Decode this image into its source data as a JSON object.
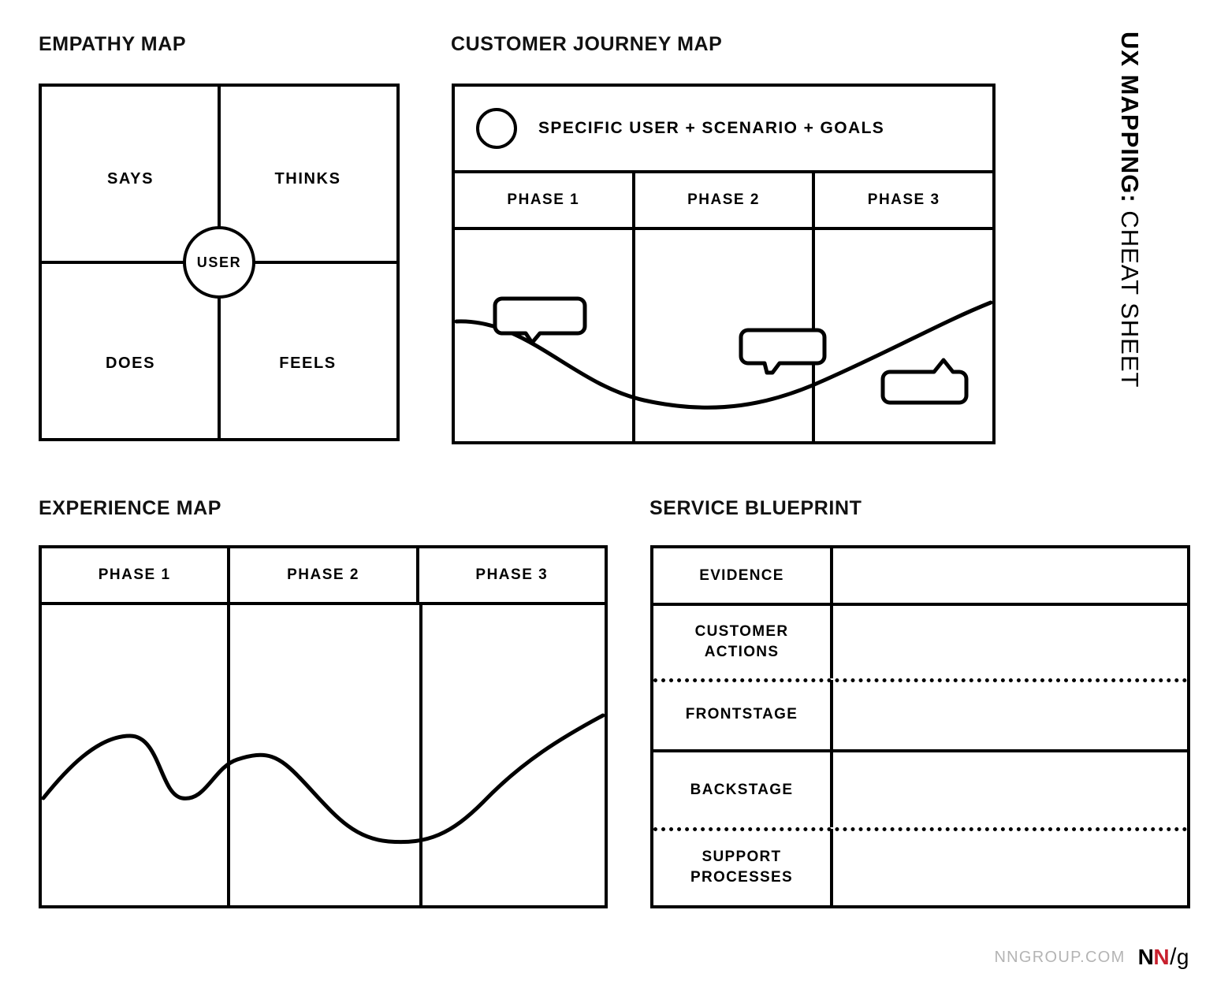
{
  "vertical_title": {
    "bold": "UX MAPPING:",
    "light": " CHEAT SHEET"
  },
  "sections": {
    "empathy": {
      "title": "EMPATHY MAP",
      "quadrants": [
        "SAYS",
        "THINKS",
        "DOES",
        "FEELS"
      ],
      "center_label": "USER"
    },
    "journey": {
      "title": "CUSTOMER JOURNEY MAP",
      "banner_text": "SPECIFIC USER + SCENARIO + GOALS",
      "banner_icon": "persona-circle-icon",
      "phases": [
        "PHASE 1",
        "PHASE 2",
        "PHASE 3"
      ],
      "bubbles": [
        "speech-bubble-down-1",
        "speech-bubble-down-2",
        "speech-bubble-up-3"
      ]
    },
    "experience": {
      "title": "EXPERIENCE MAP",
      "phases": [
        "PHASE 1",
        "PHASE 2",
        "PHASE 3"
      ]
    },
    "blueprint": {
      "title": "SERVICE BLUEPRINT",
      "rows": [
        {
          "label": "EVIDENCE",
          "divider_below": "solid"
        },
        {
          "label": "CUSTOMER\nACTIONS",
          "divider_below": "dotted"
        },
        {
          "label": "FRONTSTAGE",
          "divider_below": "solid"
        },
        {
          "label": "BACKSTAGE",
          "divider_below": "dotted"
        },
        {
          "label": "SUPPORT\nPROCESSES",
          "divider_below": "none"
        }
      ]
    }
  },
  "footer": {
    "url": "NNGROUP.COM",
    "logo": {
      "n1": "N",
      "n2": "N",
      "slash": "/",
      "g": "g"
    }
  },
  "colors": {
    "ink": "#000000",
    "background": "#ffffff",
    "footer_url": "#b4b4b4",
    "logo_red": "#c8202e"
  },
  "chart_data": [
    {
      "type": "line",
      "title": "Customer Journey Map emotional curve",
      "xlabel": "",
      "ylabel": "",
      "x": [
        0,
        0.12,
        0.25,
        0.38,
        0.5,
        0.62,
        0.75,
        0.88,
        1.0
      ],
      "y": [
        0.62,
        0.58,
        0.42,
        0.27,
        0.22,
        0.28,
        0.42,
        0.62,
        0.82
      ],
      "ylim": [
        0,
        1
      ],
      "grid": false,
      "categories": [
        "PHASE 1",
        "PHASE 2",
        "PHASE 3"
      ]
    },
    {
      "type": "line",
      "title": "Experience Map emotional curve",
      "xlabel": "",
      "ylabel": "",
      "x": [
        0,
        0.08,
        0.15,
        0.22,
        0.3,
        0.4,
        0.5,
        0.62,
        0.72,
        0.82,
        0.92,
        1.0
      ],
      "y": [
        0.55,
        0.72,
        0.74,
        0.57,
        0.48,
        0.63,
        0.66,
        0.46,
        0.31,
        0.3,
        0.48,
        0.69
      ],
      "ylim": [
        0,
        1
      ],
      "grid": false,
      "categories": [
        "PHASE 1",
        "PHASE 2",
        "PHASE 3"
      ]
    }
  ]
}
